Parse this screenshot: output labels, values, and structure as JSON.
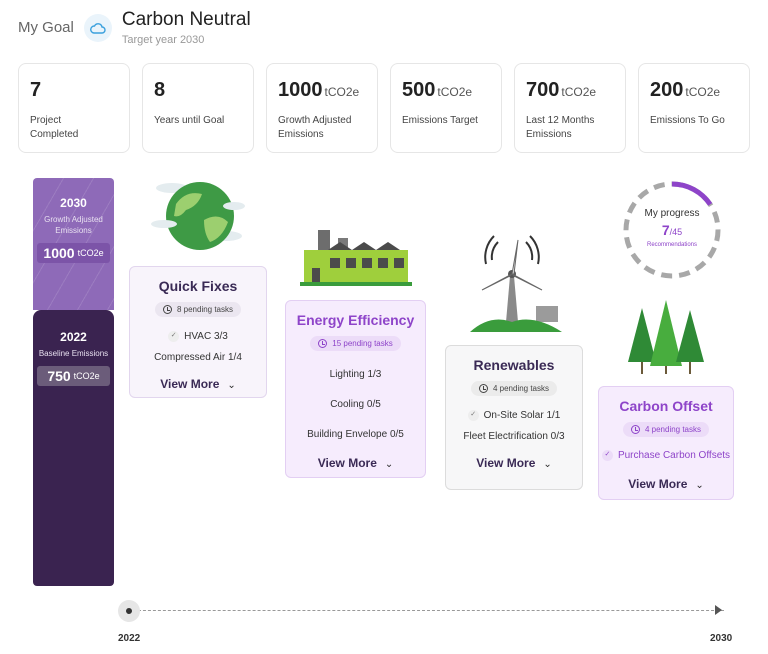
{
  "header": {
    "goal_label": "My Goal",
    "title": "Carbon Neutral",
    "subtitle": "Target year 2030",
    "icon": "cloud-icon"
  },
  "stats": [
    {
      "value": "7",
      "unit": "",
      "label": "Project Completed"
    },
    {
      "value": "8",
      "unit": "",
      "label": "Years until Goal"
    },
    {
      "value": "1000",
      "unit": "tCO2e",
      "label": "Growth Adjusted Emissions"
    },
    {
      "value": "500",
      "unit": "tCO2e",
      "label": "Emissions Target"
    },
    {
      "value": "700",
      "unit": "tCO2e",
      "label": "Last 12 Months Emissions"
    },
    {
      "value": "200",
      "unit": "tCO2e",
      "label": "Emissions To Go"
    }
  ],
  "bar": {
    "top": {
      "year": "2030",
      "desc": "Growth Adjusted Emissions",
      "value": "1000",
      "unit": "tCO2e"
    },
    "bottom": {
      "year": "2022",
      "desc": "Baseline Emissions",
      "value": "750",
      "unit": "tCO2e"
    }
  },
  "progress": {
    "title": "My progress",
    "done": "7",
    "total": "/45",
    "label": "Recommendations"
  },
  "cards": {
    "quick": {
      "title": "Quick Fixes",
      "pending": "8 pending tasks",
      "items": [
        "HVAC 3/3",
        "Compressed Air 1/4"
      ],
      "view_more": "View More"
    },
    "energy": {
      "title": "Energy Efficiency",
      "pending": "15 pending tasks",
      "items": [
        "Lighting 1/3",
        "Cooling 0/5",
        "Building Envelope 0/5"
      ],
      "view_more": "View More"
    },
    "renew": {
      "title": "Renewables",
      "pending": "4 pending tasks",
      "items": [
        "On-Site Solar 1/1",
        "Fleet Electrification 0/3"
      ],
      "view_more": "View More"
    },
    "offset": {
      "title": "Carbon Offset",
      "pending": "4 pending tasks",
      "items": [
        "Purchase Carbon Offsets"
      ],
      "view_more": "View More"
    }
  },
  "timeline": {
    "start": "2022",
    "end": "2030"
  },
  "colors": {
    "purple": "#8e44c9",
    "dark_purple": "#3a2350",
    "light_purple": "#8e6ab8",
    "card_tint": "#f7effd",
    "green": "#3a9c3c"
  }
}
